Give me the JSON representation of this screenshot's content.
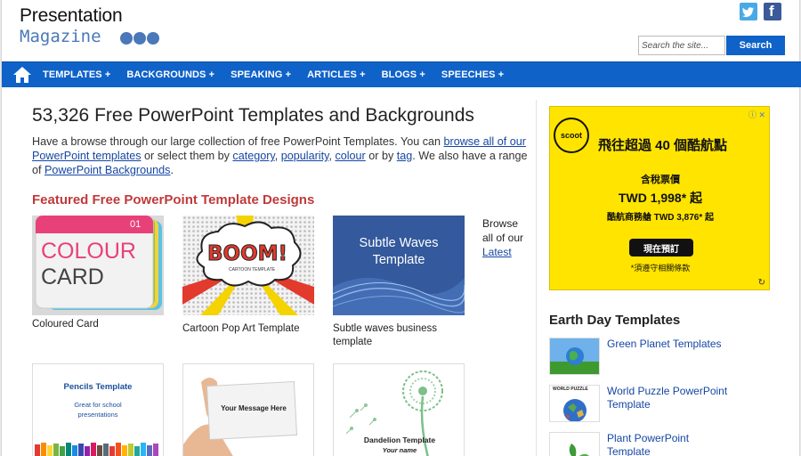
{
  "header": {
    "logo_top": "Presentation",
    "logo_bottom": "Magazine",
    "search_placeholder": "Search the site...",
    "search_button": "Search",
    "social": [
      "twitter-icon",
      "facebook-icon"
    ]
  },
  "nav": {
    "items": [
      {
        "label": "TEMPLATES +"
      },
      {
        "label": "BACKGROUNDS +"
      },
      {
        "label": "SPEAKING +"
      },
      {
        "label": "ARTICLES +"
      },
      {
        "label": "BLOGS +"
      },
      {
        "label": "SPEECHES +"
      }
    ]
  },
  "main": {
    "title": "53,326 Free PowerPoint Templates and Backgrounds",
    "intro": {
      "t1": "Have a browse through our large collection of free PowerPoint Templates. You can ",
      "l1": "browse all of our PowerPoint templates",
      "t2": " or select them by ",
      "l2": "category",
      "t3": ", ",
      "l3": "popularity",
      "t4": ", ",
      "l4": "colour",
      "t5": " or by ",
      "l5": "tag",
      "t6": ". We also have a range of ",
      "l6": "PowerPoint Backgrounds",
      "t7": "."
    },
    "featured_heading": "Featured Free PowerPoint Template Designs",
    "templates": [
      {
        "caption": "Coloured Card",
        "thumb_text": "COLOUR",
        "thumb_text2": "CARD",
        "thumb_num": "01"
      },
      {
        "caption": "Cartoon Pop Art Template",
        "thumb_text": "BOOM!",
        "thumb_text2": "CARTOON TEMPLATE"
      },
      {
        "caption": "Subtle waves business template",
        "thumb_text": "Subtle Waves Template"
      },
      {
        "caption": "",
        "thumb_text": "Pencils Template",
        "thumb_text2": "Great for school presentations"
      },
      {
        "caption": "",
        "thumb_text": "Your Message Here"
      },
      {
        "caption": "",
        "thumb_text": "Dandelion Template",
        "thumb_text2": "Your name"
      }
    ],
    "browse": {
      "prefix": "Browse all of our",
      "link": "Latest"
    }
  },
  "sidebar": {
    "ad": {
      "brand": "scoot",
      "line1": "飛往超過 40 個酷航點",
      "line2": "含稅票價",
      "line3": "TWD 1,998* 起",
      "line4": "酷航商務艙 TWD 3,876* 起",
      "cta": "現在預訂",
      "note": "*須遵守相關條款",
      "info": "ⓘ ✕"
    },
    "section_title": "Earth Day Templates",
    "items": [
      {
        "label": "Green Planet Templates"
      },
      {
        "label": "World Puzzle PowerPoint Template",
        "thumb_text": "WORLD PUZZLE"
      },
      {
        "label": "Plant PowerPoint Template"
      }
    ]
  },
  "colors": {
    "nav_blue": "#0f62c8",
    "link": "#1546a3",
    "accent_red": "#c0393b",
    "ad_yellow": "#ffe400"
  }
}
